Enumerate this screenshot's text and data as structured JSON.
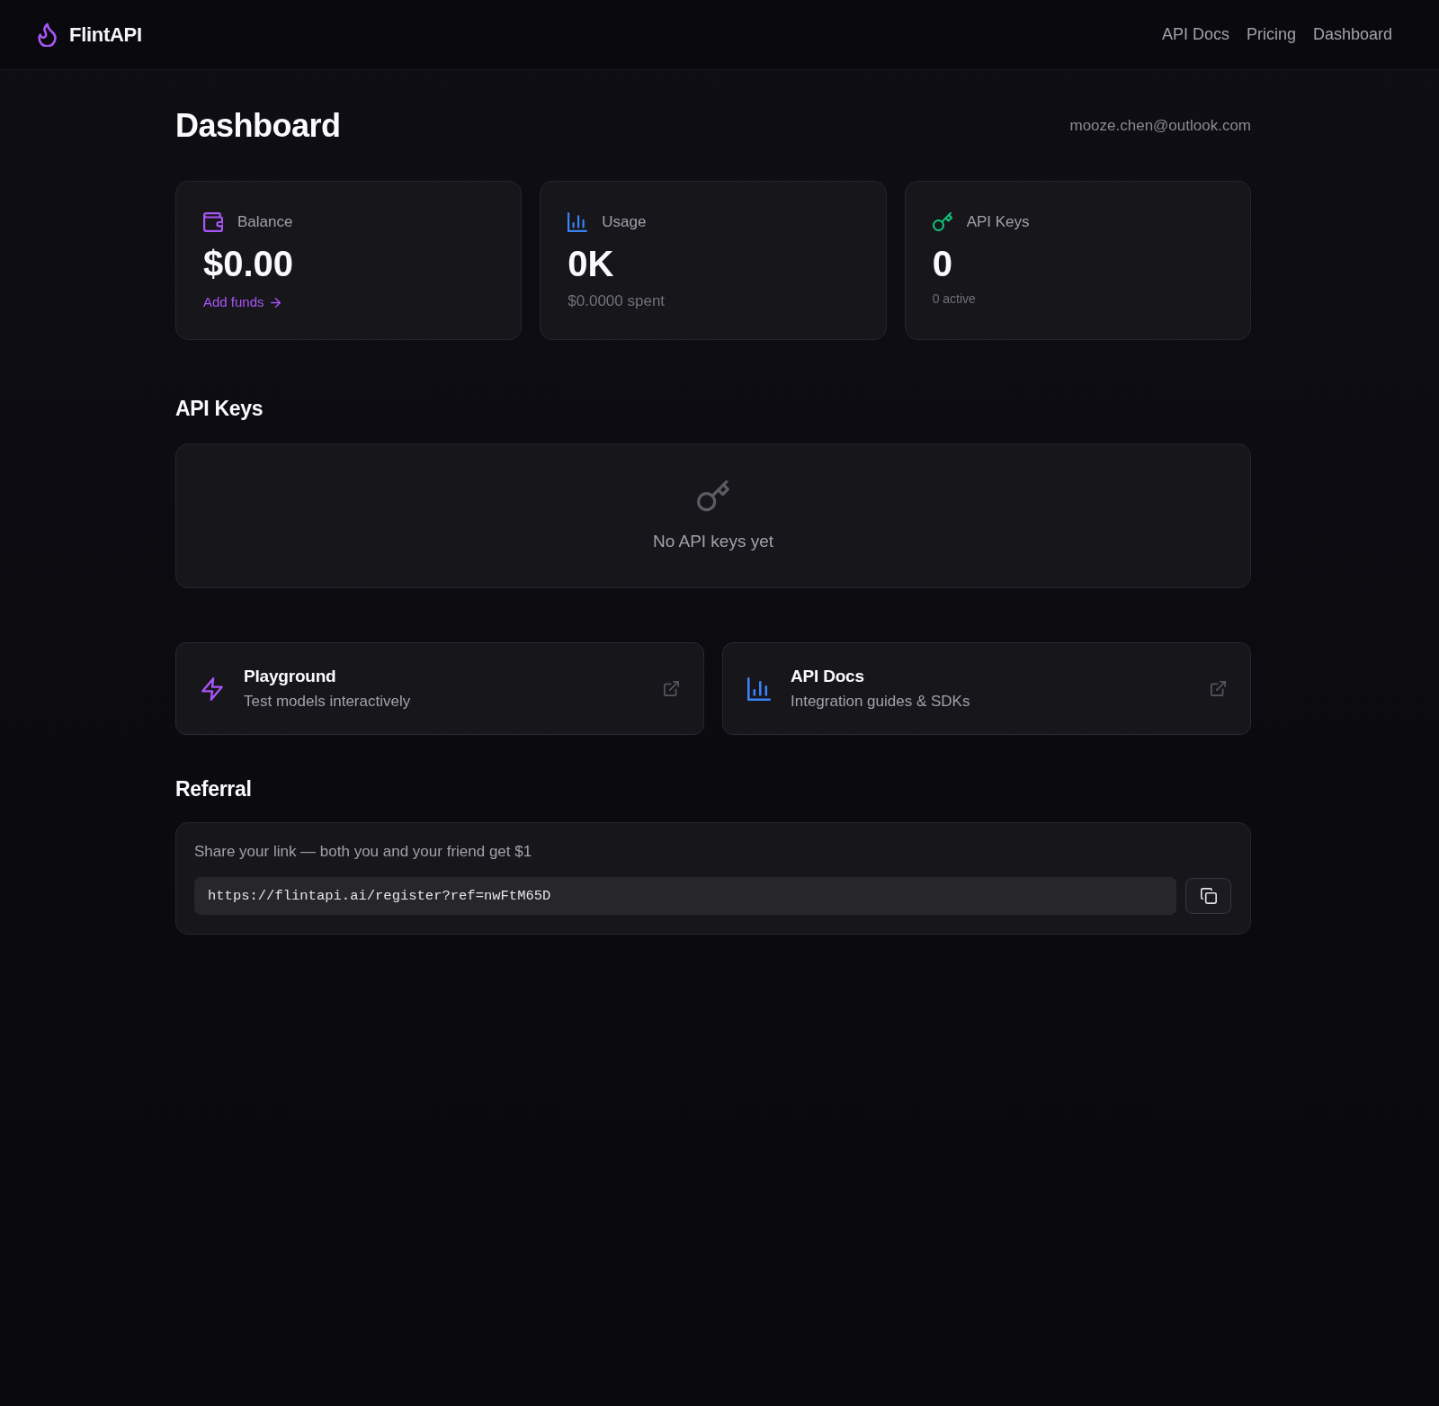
{
  "nav": {
    "brand": "FlintAPI",
    "links": [
      {
        "label": "API Docs"
      },
      {
        "label": "Pricing"
      },
      {
        "label": "Dashboard"
      }
    ]
  },
  "header": {
    "title": "Dashboard",
    "email": "mooze.chen@outlook.com"
  },
  "stats": [
    {
      "kind": "balance",
      "label": "Balance",
      "value": "$0.00",
      "link": "Add funds",
      "color": "#a855f7"
    },
    {
      "kind": "usage",
      "label": "Usage",
      "value": "0K",
      "note": "$0.0000 spent",
      "color": "#3b82f6"
    },
    {
      "kind": "keys",
      "label": "API Keys",
      "value": "0",
      "note": "0 active",
      "color": "#10c77e"
    }
  ],
  "api_keys": {
    "title": "API Keys",
    "empty_text": "No API keys yet"
  },
  "shortcuts": [
    {
      "kind": "playground",
      "title": "Playground",
      "subtitle": "Test models interactively",
      "color": "#a855f7"
    },
    {
      "kind": "docs",
      "title": "API Docs",
      "subtitle": "Integration guides & SDKs",
      "color": "#3b82f6"
    }
  ],
  "referral": {
    "title": "Referral",
    "text": "Share your link — both you and your friend get $1",
    "link_field": {
      "value": "https://flintapi.ai/register?ref=nwFtM65D"
    }
  }
}
